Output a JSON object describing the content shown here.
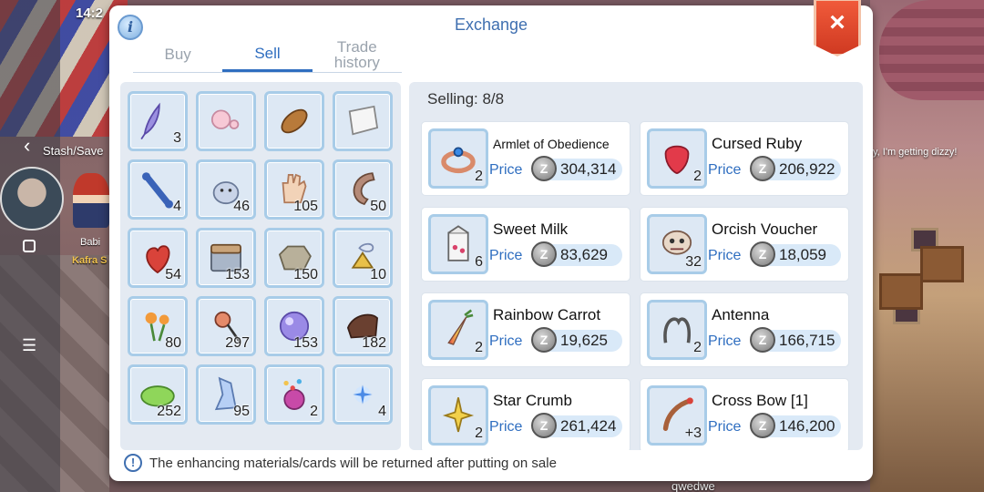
{
  "status": {
    "time": "14:2"
  },
  "hud": {
    "stash_label": "Stash/Save",
    "npc_name": "Babi",
    "npc_guild": "Kafra S",
    "chat_text": "y, I'm getting dizzy!",
    "player_name": "qwedwe"
  },
  "dialog": {
    "title": "Exchange",
    "close_label": "×",
    "tabs": [
      {
        "label": "Buy",
        "active": false
      },
      {
        "label": "Sell",
        "active": true
      },
      {
        "label": "Trade history",
        "active": false
      }
    ],
    "inventory": [
      {
        "icon": "feather-icon",
        "count": "3"
      },
      {
        "icon": "pearl-icon",
        "count": ""
      },
      {
        "icon": "seed-icon",
        "count": ""
      },
      {
        "icon": "scroll-icon",
        "count": ""
      },
      {
        "icon": "bone-icon",
        "count": "4"
      },
      {
        "icon": "creature-icon",
        "count": "46"
      },
      {
        "icon": "glove-icon",
        "count": "105"
      },
      {
        "icon": "horn-icon",
        "count": "50"
      },
      {
        "icon": "heart-icon",
        "count": "54"
      },
      {
        "icon": "chest-icon",
        "count": "153"
      },
      {
        "icon": "stone-icon",
        "count": "150"
      },
      {
        "icon": "powder-icon",
        "count": "10"
      },
      {
        "icon": "flower-icon",
        "count": "80"
      },
      {
        "icon": "necklace-icon",
        "count": "297"
      },
      {
        "icon": "orb-icon",
        "count": "153"
      },
      {
        "icon": "leather-icon",
        "count": "182"
      },
      {
        "icon": "slime-icon",
        "count": "252"
      },
      {
        "icon": "crystal-icon",
        "count": "95"
      },
      {
        "icon": "gift-icon",
        "count": "2"
      },
      {
        "icon": "sparkle-icon",
        "count": "4"
      }
    ],
    "selling_label": "Selling: 8/8",
    "price_label": "Price",
    "zeny_symbol": "Z",
    "listings": [
      {
        "name": "Armlet of Obedience",
        "count": "2",
        "price": "304,314",
        "icon": "ring-icon"
      },
      {
        "name": "Cursed Ruby",
        "count": "2",
        "price": "206,922",
        "icon": "ruby-icon"
      },
      {
        "name": "Sweet Milk",
        "count": "6",
        "price": "83,629",
        "icon": "milk-icon"
      },
      {
        "name": "Orcish Voucher",
        "count": "32",
        "price": "18,059",
        "icon": "voucher-icon"
      },
      {
        "name": "Rainbow Carrot",
        "count": "2",
        "price": "19,625",
        "icon": "carrot-icon"
      },
      {
        "name": "Antenna",
        "count": "2",
        "price": "166,715",
        "icon": "antenna-icon"
      },
      {
        "name": "Star Crumb",
        "count": "2",
        "price": "261,424",
        "icon": "star-crumb-icon"
      },
      {
        "name": "Cross Bow [1]",
        "count": "+3",
        "price": "146,200",
        "icon": "crossbow-icon"
      }
    ],
    "footer_text": "The enhancing materials/cards will be returned after putting on sale",
    "colors": {
      "accent": "#2f6ec0",
      "close": "#e04a2e",
      "slot_border": "#a8cce8"
    }
  }
}
